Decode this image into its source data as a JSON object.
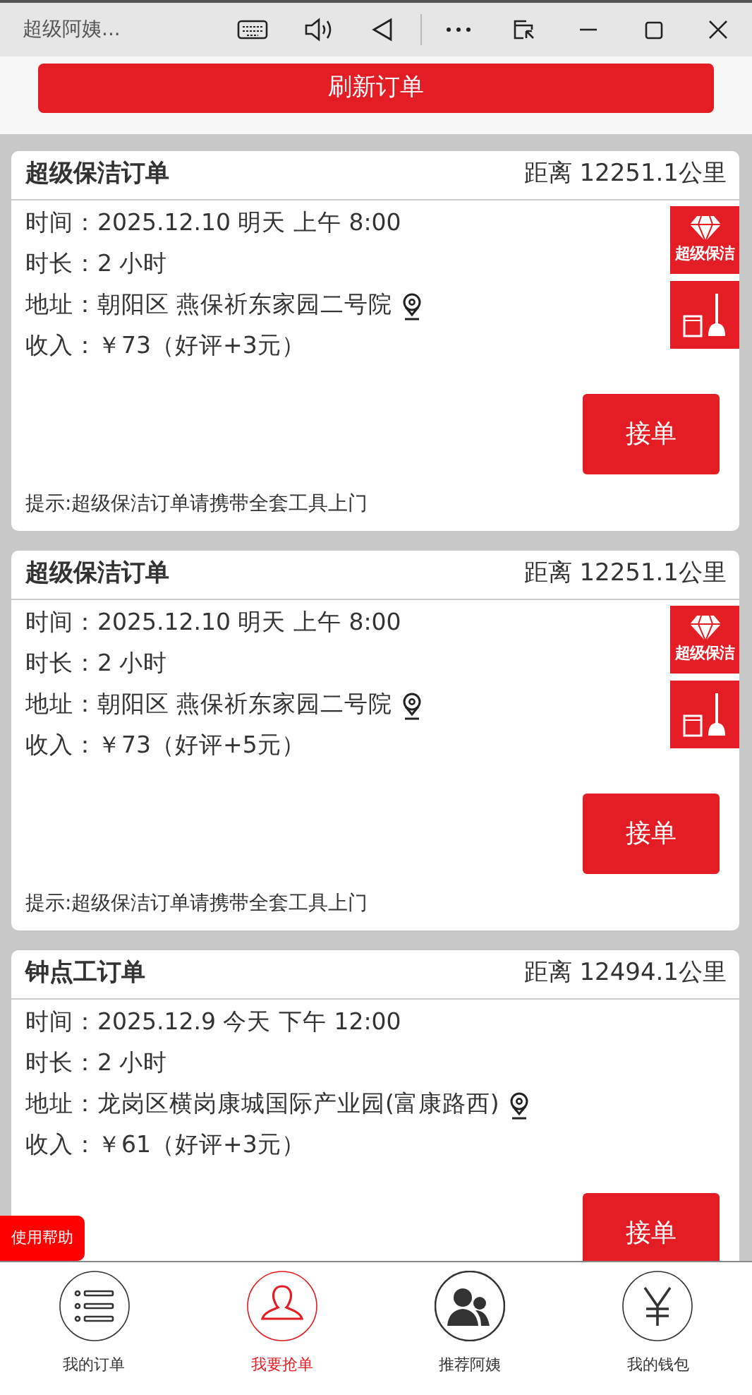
{
  "window": {
    "title": "超级阿姨..."
  },
  "refresh_button": "刷新订单",
  "orders": [
    {
      "kind": "super",
      "title": "超级保洁订单",
      "distance": "距离 12251.1公里",
      "fields": [
        {
          "kind": "text",
          "label": "时间：",
          "value": "2025.12.10 明天 上午 8:00"
        },
        {
          "kind": "text",
          "label": "时长：",
          "value": "2 小时"
        },
        {
          "kind": "address",
          "label": "地址：",
          "value": "朝阳区 燕保祈东家园二号院"
        },
        {
          "kind": "text",
          "label": "收入：",
          "value": "￥73（好评+3元）"
        }
      ],
      "badge_label": "超级保洁",
      "accept_button": "接单",
      "hint": "提示:超级保洁订单请携带全套工具上门"
    },
    {
      "kind": "super",
      "title": "超级保洁订单",
      "distance": "距离 12251.1公里",
      "fields": [
        {
          "kind": "text",
          "label": "时间：",
          "value": "2025.12.10 明天 上午 8:00"
        },
        {
          "kind": "text",
          "label": "时长：",
          "value": "2 小时"
        },
        {
          "kind": "address",
          "label": "地址：",
          "value": "朝阳区 燕保祈东家园二号院"
        },
        {
          "kind": "text",
          "label": "收入：",
          "value": "￥73（好评+5元）"
        }
      ],
      "badge_label": "超级保洁",
      "accept_button": "接单",
      "hint": "提示:超级保洁订单请携带全套工具上门"
    },
    {
      "kind": "hourly",
      "title": "钟点工订单",
      "distance": "距离 12494.1公里",
      "fields": [
        {
          "kind": "text",
          "label": "时间：",
          "value": "2025.12.9 今天 下午 12:00"
        },
        {
          "kind": "text",
          "label": "时长：",
          "value": "2 小时"
        },
        {
          "kind": "address",
          "label": "地址：",
          "value": "龙岗区横岗康城国际产业园(富康路西)"
        },
        {
          "kind": "text",
          "label": "收入：",
          "value": "￥61（好评+3元）"
        }
      ],
      "accept_button": "接单"
    }
  ],
  "help_button": "使用帮助",
  "tabs": [
    {
      "label": "我的订单",
      "selected": false
    },
    {
      "label": "我要抢单",
      "selected": true
    },
    {
      "label": "推荐阿姨",
      "selected": false
    },
    {
      "label": "我的钱包",
      "selected": false
    }
  ]
}
